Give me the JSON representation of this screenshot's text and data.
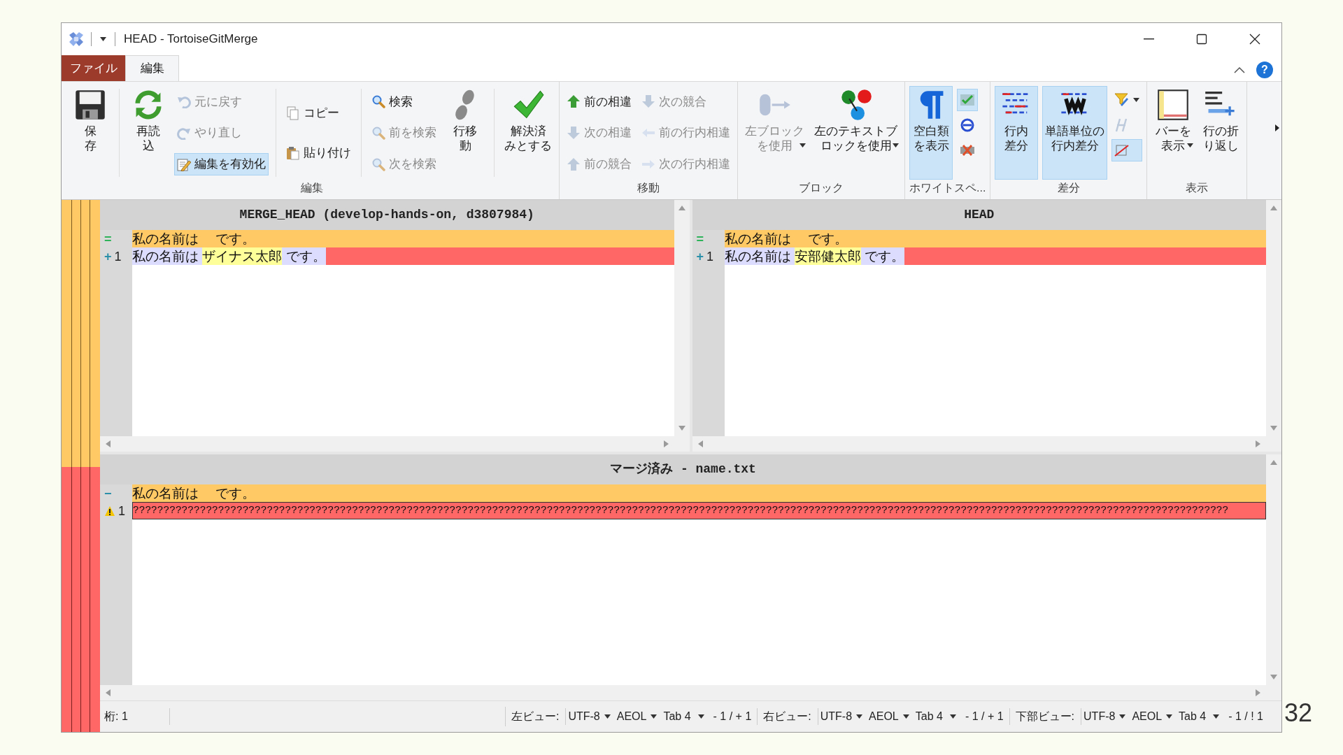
{
  "slide": {
    "page_number": "32"
  },
  "window": {
    "title": "HEAD - TortoiseGitMerge"
  },
  "ribbon": {
    "tabs": [
      {
        "label": "ファイル",
        "kind": "file",
        "selected": false
      },
      {
        "label": "編集",
        "kind": "tab",
        "selected": true
      }
    ],
    "help": "?",
    "groups": [
      {
        "label": "編集",
        "columns": [
          {
            "kind": "large",
            "buttons": [
              {
                "lines": [
                  "保",
                  "存"
                ],
                "on": false,
                "disabled": false,
                "dropdown": false
              }
            ]
          },
          {
            "kind": "separator"
          },
          {
            "kind": "large",
            "buttons": [
              {
                "lines": [
                  "再読",
                  "込"
                ],
                "on": false,
                "disabled": false,
                "dropdown": false
              }
            ]
          },
          {
            "kind": "stack",
            "buttons": [
              {
                "lines": [
                  "元に戻す"
                ],
                "on": false,
                "disabled": true,
                "dropdown": false
              },
              {
                "lines": [
                  "やり直し"
                ],
                "on": false,
                "disabled": true,
                "dropdown": false
              },
              {
                "lines": [
                  "編集を有効化"
                ],
                "on": true,
                "disabled": false,
                "dropdown": false
              }
            ]
          },
          {
            "kind": "separator"
          },
          {
            "kind": "stack",
            "buttons": [
              {
                "lines": [
                  "コピー"
                ],
                "on": false,
                "disabled": false,
                "dropdown": false
              },
              {
                "lines": [
                  "貼り付け"
                ],
                "on": false,
                "disabled": false,
                "dropdown": false
              }
            ]
          },
          {
            "kind": "separator"
          },
          {
            "kind": "stack",
            "buttons": [
              {
                "lines": [
                  "検索"
                ],
                "on": false,
                "disabled": false,
                "dropdown": false
              },
              {
                "lines": [
                  "前を検索"
                ],
                "on": false,
                "disabled": true,
                "dropdown": false
              },
              {
                "lines": [
                  "次を検索"
                ],
                "on": false,
                "disabled": true,
                "dropdown": false
              }
            ]
          },
          {
            "kind": "large",
            "buttons": [
              {
                "lines": [
                  "行移",
                  "動"
                ],
                "on": false,
                "disabled": false,
                "dropdown": false
              }
            ]
          },
          {
            "kind": "separator"
          },
          {
            "kind": "large",
            "buttons": [
              {
                "lines": [
                  "解決済",
                  "みとする"
                ],
                "on": false,
                "disabled": false,
                "dropdown": false
              }
            ]
          }
        ]
      },
      {
        "label": "移動",
        "columns": [
          {
            "kind": "stack",
            "buttons": [
              {
                "lines": [
                  "前の相違"
                ],
                "on": false,
                "disabled": false,
                "dropdown": false
              },
              {
                "lines": [
                  "次の相違"
                ],
                "on": false,
                "disabled": true,
                "dropdown": false
              },
              {
                "lines": [
                  "前の競合"
                ],
                "on": false,
                "disabled": true,
                "dropdown": false
              }
            ]
          },
          {
            "kind": "stack",
            "buttons": [
              {
                "lines": [
                  "次の競合"
                ],
                "on": false,
                "disabled": true,
                "dropdown": false
              },
              {
                "lines": [
                  "前の行内相違"
                ],
                "on": false,
                "disabled": true,
                "dropdown": false
              },
              {
                "lines": [
                  "次の行内相違"
                ],
                "on": false,
                "disabled": true,
                "dropdown": false
              }
            ]
          }
        ]
      },
      {
        "label": "ブロック",
        "columns": [
          {
            "kind": "large",
            "buttons": [
              {
                "lines": [
                  "左ブロック",
                  "を使用"
                ],
                "on": false,
                "disabled": true,
                "dropdown": true
              }
            ]
          },
          {
            "kind": "large",
            "buttons": [
              {
                "lines": [
                  "左のテキストブ",
                  "ロックを使用"
                ],
                "on": false,
                "disabled": false,
                "dropdown": true
              }
            ]
          }
        ]
      },
      {
        "label": "ホワイトスペ...",
        "columns": [
          {
            "kind": "large",
            "buttons": [
              {
                "lines": [
                  "空白類",
                  "を表示"
                ],
                "on": true,
                "disabled": false,
                "dropdown": false
              }
            ]
          },
          {
            "kind": "icons",
            "buttons": [
              {
                "on": true,
                "disabled": false,
                "dropdown": false
              },
              {
                "on": false,
                "disabled": false,
                "dropdown": false
              },
              {
                "on": false,
                "disabled": false,
                "dropdown": false
              }
            ]
          }
        ]
      },
      {
        "label": "差分",
        "columns": [
          {
            "kind": "large",
            "buttons": [
              {
                "lines": [
                  "行内",
                  "差分"
                ],
                "on": true,
                "disabled": false,
                "dropdown": false
              }
            ]
          },
          {
            "kind": "large",
            "buttons": [
              {
                "lines": [
                  "単語単位の",
                  "行内差分"
                ],
                "on": true,
                "disabled": false,
                "dropdown": false
              }
            ]
          },
          {
            "kind": "icons",
            "buttons": [
              {
                "on": false,
                "disabled": false,
                "dropdown": true
              },
              {
                "on": false,
                "disabled": true,
                "dropdown": false
              },
              {
                "on": true,
                "disabled": false,
                "dropdown": false
              }
            ]
          }
        ]
      },
      {
        "label": "表示",
        "columns": [
          {
            "kind": "large",
            "buttons": [
              {
                "lines": [
                  "バーを",
                  "表示"
                ],
                "on": false,
                "disabled": false,
                "dropdown": true
              }
            ]
          },
          {
            "kind": "large",
            "buttons": [
              {
                "lines": [
                  "行の折",
                  "り返し"
                ],
                "on": false,
                "disabled": false,
                "dropdown": false
              }
            ]
          }
        ]
      }
    ]
  },
  "top_panes": [
    {
      "title": "MERGE_HEAD (develop-hands-on, d3807984)",
      "lines": [
        {
          "kind": "same",
          "marker": "=",
          "segments": [
            {
              "text": "私の名前は　 です。",
              "changed": false
            }
          ]
        },
        {
          "kind": "added",
          "marker": "+",
          "number": "1",
          "segments": [
            {
              "text": "私の名前は ",
              "changed": false
            },
            {
              "text": "ザイナス太郎",
              "changed": true
            },
            {
              "text": " です。",
              "changed": false
            }
          ]
        }
      ]
    },
    {
      "title": "HEAD",
      "lines": [
        {
          "kind": "same",
          "marker": "=",
          "segments": [
            {
              "text": "私の名前は　 です。",
              "changed": false
            }
          ]
        },
        {
          "kind": "added",
          "marker": "+",
          "number": "1",
          "segments": [
            {
              "text": "私の名前は ",
              "changed": false
            },
            {
              "text": "安部健太郎",
              "changed": true
            },
            {
              "text": " です。",
              "changed": false
            }
          ]
        }
      ]
    }
  ],
  "bottom_pane": {
    "title": "マージ済み - name.txt",
    "lines": [
      {
        "kind": "removed",
        "marker": "−",
        "segments": [
          {
            "text": "私の名前は　 です。",
            "changed": false
          }
        ]
      },
      {
        "kind": "conflict",
        "number": "1",
        "segments": [
          {
            "text": "????????????????????????????????????????????????????????????????????????????????????????????????????????????????????????????????????????????????????????????????????????????????????",
            "changed": false
          }
        ]
      }
    ]
  },
  "status_bar": {
    "position": "桁: 1",
    "views": [
      {
        "label": "左ビュー:",
        "encoding": "UTF-8",
        "eol": "AEOL",
        "tab": "Tab 4",
        "counts": "- 1 / + 1"
      },
      {
        "label": "右ビュー:",
        "encoding": "UTF-8",
        "eol": "AEOL",
        "tab": "Tab 4",
        "counts": "- 1 / + 1"
      },
      {
        "label": "下部ビュー:",
        "encoding": "UTF-8",
        "eol": "AEOL",
        "tab": "Tab 4",
        "counts": "- 1 / ! 1"
      }
    ]
  }
}
